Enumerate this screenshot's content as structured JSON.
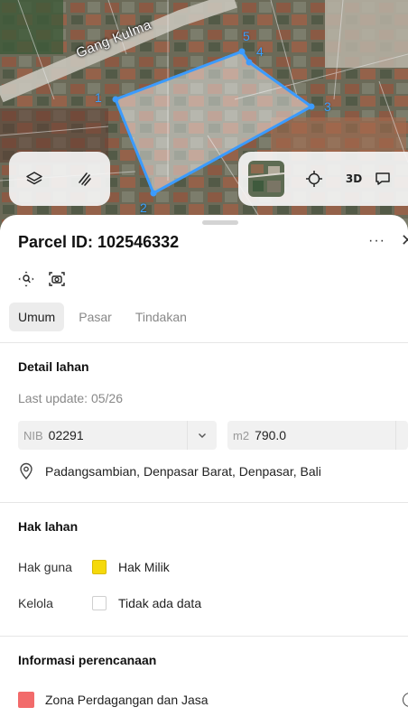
{
  "map": {
    "street_label": "Gang Kulma",
    "vertex_labels": [
      "1",
      "2",
      "3",
      "4",
      "5"
    ],
    "parcel_color": "#3b9bff",
    "tools_left": [
      {
        "name": "layers-icon"
      },
      {
        "name": "measure-icon"
      }
    ],
    "tools_right": [
      {
        "name": "satellite-thumbnail"
      },
      {
        "name": "locate-icon"
      },
      {
        "name": "3d-button",
        "label": "3D"
      },
      {
        "name": "feedback-icon"
      }
    ]
  },
  "sheet": {
    "title": "Parcel ID: 102546332",
    "more_label": "···",
    "close_label": "✕",
    "tabs": [
      {
        "label": "Umum",
        "active": true
      },
      {
        "label": "Pasar",
        "active": false
      },
      {
        "label": "Tindakan",
        "active": false
      }
    ],
    "detail": {
      "heading": "Detail lahan",
      "last_update": "Last update: 05/26",
      "nib_prefix": "NIB",
      "nib_value": "02291",
      "area_prefix": "m2",
      "area_value": "790.0",
      "location": "Padangsambian, Denpasar Barat, Denpasar, Bali"
    },
    "rights": {
      "heading": "Hak lahan",
      "rows": [
        {
          "label": "Hak guna",
          "value": "Hak Milik",
          "color": "#f5d90a"
        },
        {
          "label": "Kelola",
          "value": "Tidak ada data",
          "color": "#ffffff"
        }
      ]
    },
    "planning": {
      "heading": "Informasi perencanaan",
      "zone": "Zona Perdagangan dan Jasa",
      "zone_color": "#f26b6b"
    }
  }
}
